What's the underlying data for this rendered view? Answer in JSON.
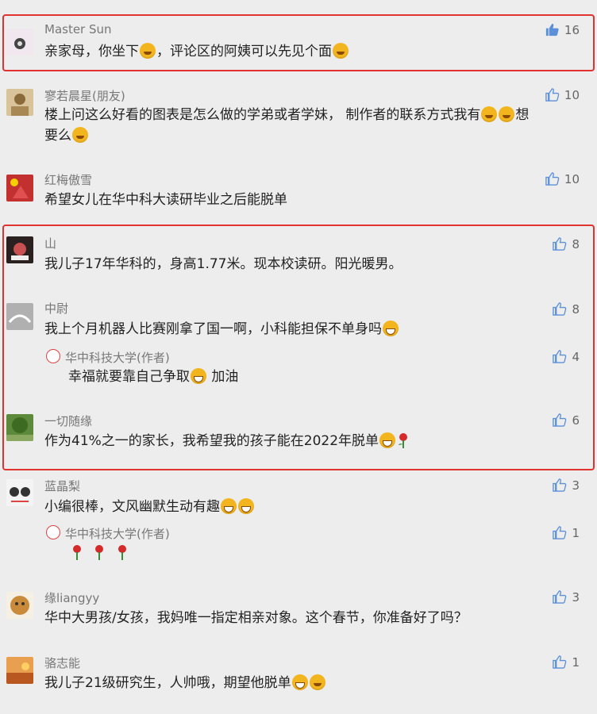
{
  "colors": {
    "background": "#ededed",
    "highlight_frame": "#e0322e",
    "like_filled": "#5b8fd8",
    "like_outline": "#5b8fd8"
  },
  "comments": [
    {
      "name": "Master Sun",
      "text": "亲家母，你坐下",
      "text2": "，评论区的阿姨可以先见个面",
      "likes": "16",
      "liked": true
    },
    {
      "name": "寥若晨星(朋友)",
      "text": "楼上问这么好看的图表是怎么做的学弟或者学妹， 制作者的联系方式我有",
      "text_cont": "想",
      "text_line2": "要么",
      "likes": "10"
    },
    {
      "name": "红梅傲雪",
      "text": "希望女儿在华中科大读研毕业之后能脱单",
      "likes": "10"
    },
    {
      "name": "山",
      "text": "我儿子17年华科的，身高1.77米。现本校读研。阳光暖男。",
      "likes": "8"
    },
    {
      "name": "中尉",
      "text": "我上个月机器人比赛刚拿了国一啊，小科能担保不单身吗",
      "likes": "8"
    },
    {
      "name": "华中科技大学(作者)",
      "text": "幸福就要靠自己争取",
      "text2": " 加油",
      "likes": "4",
      "is_reply": true
    },
    {
      "name": "一切随缘",
      "text": "作为41%之一的家长，我希望我的孩子能在2022年脱单",
      "likes": "6"
    },
    {
      "name": "蓝晶梨",
      "text": "小编很棒，文风幽默生动有趣",
      "likes": "3"
    },
    {
      "name": "华中科技大学(作者)",
      "text": "",
      "likes": "1",
      "is_reply": true
    },
    {
      "name": "缘liangyy",
      "text": "华中大男孩/女孩，我妈唯一指定相亲对象。这个春节，你准备好了吗？",
      "likes": "3"
    },
    {
      "name": "骆志能",
      "text": "我儿子21级研究生，人帅哦，期望他脱单",
      "likes": "1"
    }
  ],
  "icons": {
    "like": "thumbs-up-icon",
    "emoji_laugh": "laugh-emoji-icon",
    "emoji_grin": "grin-emoji-icon",
    "rose": "rose-icon",
    "author_badge": "author-badge-icon"
  }
}
